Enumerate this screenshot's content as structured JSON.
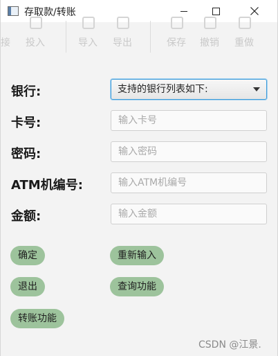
{
  "window": {
    "title": "存取款/转账",
    "icons": {
      "app": "app-window-icon",
      "minimize": "minimize-icon",
      "maximize": "maximize-icon",
      "close": "close-icon"
    }
  },
  "background_toolbar": {
    "items": [
      "接",
      "投入",
      "导入",
      "导出",
      "保存",
      "撤销",
      "重做"
    ]
  },
  "form": {
    "bank_label": "银行:",
    "bank_required_mark": ":",
    "bank_select_value": "支持的银行列表如下:",
    "card_label": "卡号:",
    "card_placeholder": "输入卡号",
    "password_label": "密码:",
    "password_placeholder": "输入密码",
    "atm_label": "ATM机编号:",
    "atm_placeholder": "输入ATM机编号",
    "amount_label": "金额:",
    "amount_placeholder": "输入金额"
  },
  "buttons": {
    "confirm": "确定",
    "reset": "重新输入",
    "exit": "退出",
    "query": "查询功能",
    "transfer": "转账功能"
  },
  "colors": {
    "button_bg": "#9dc39c",
    "select_focus_border": "#3a9ad9"
  },
  "watermark": "CSDN @江景."
}
